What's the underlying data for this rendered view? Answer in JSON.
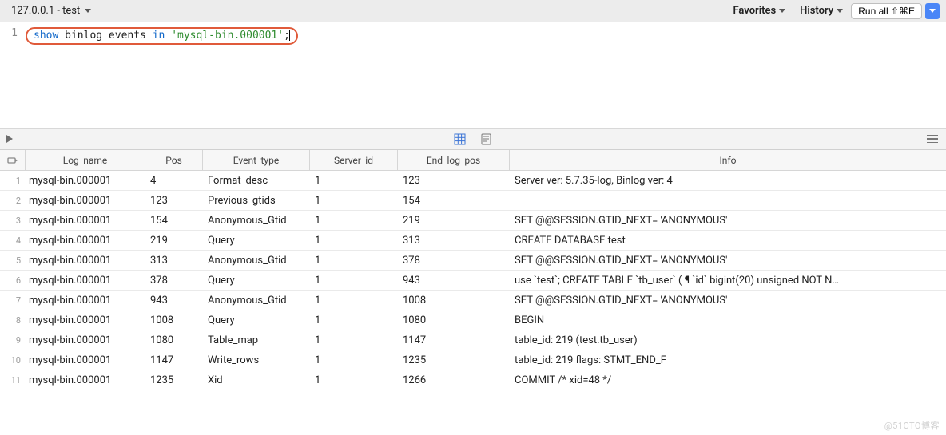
{
  "toolbar": {
    "tab_label": "127.0.0.1 - test",
    "favorites": "Favorites",
    "history": "History",
    "run_all": "Run all ⇧⌘E"
  },
  "editor": {
    "line_number": "1",
    "sql_kw1": "show",
    "sql_plain1": " binlog events ",
    "sql_kw2": "in",
    "sql_plain2": " ",
    "sql_string": "'mysql-bin.000001'",
    "sql_semicolon": ";"
  },
  "table": {
    "headers": {
      "log_name": "Log_name",
      "pos": "Pos",
      "event_type": "Event_type",
      "server_id": "Server_id",
      "end_log_pos": "End_log_pos",
      "info": "Info"
    },
    "rows": [
      {
        "n": "1",
        "log": "mysql-bin.000001",
        "pos": "4",
        "evt": "Format_desc",
        "srv": "1",
        "end": "123",
        "info": "Server ver: 5.7.35-log, Binlog ver: 4"
      },
      {
        "n": "2",
        "log": "mysql-bin.000001",
        "pos": "123",
        "evt": "Previous_gtids",
        "srv": "1",
        "end": "154",
        "info": ""
      },
      {
        "n": "3",
        "log": "mysql-bin.000001",
        "pos": "154",
        "evt": "Anonymous_Gtid",
        "srv": "1",
        "end": "219",
        "info": "SET @@SESSION.GTID_NEXT= 'ANONYMOUS'"
      },
      {
        "n": "4",
        "log": "mysql-bin.000001",
        "pos": "219",
        "evt": "Query",
        "srv": "1",
        "end": "313",
        "info": "CREATE DATABASE test"
      },
      {
        "n": "5",
        "log": "mysql-bin.000001",
        "pos": "313",
        "evt": "Anonymous_Gtid",
        "srv": "1",
        "end": "378",
        "info": "SET @@SESSION.GTID_NEXT= 'ANONYMOUS'"
      },
      {
        "n": "6",
        "log": "mysql-bin.000001",
        "pos": "378",
        "evt": "Query",
        "srv": "1",
        "end": "943",
        "info": "use `test`; CREATE TABLE `tb_user` ( ¶   `id` bigint(20) unsigned NOT N…"
      },
      {
        "n": "7",
        "log": "mysql-bin.000001",
        "pos": "943",
        "evt": "Anonymous_Gtid",
        "srv": "1",
        "end": "1008",
        "info": "SET @@SESSION.GTID_NEXT= 'ANONYMOUS'"
      },
      {
        "n": "8",
        "log": "mysql-bin.000001",
        "pos": "1008",
        "evt": "Query",
        "srv": "1",
        "end": "1080",
        "info": "BEGIN"
      },
      {
        "n": "9",
        "log": "mysql-bin.000001",
        "pos": "1080",
        "evt": "Table_map",
        "srv": "1",
        "end": "1147",
        "info": "table_id: 219 (test.tb_user)"
      },
      {
        "n": "10",
        "log": "mysql-bin.000001",
        "pos": "1147",
        "evt": "Write_rows",
        "srv": "1",
        "end": "1235",
        "info": "table_id: 219 flags: STMT_END_F"
      },
      {
        "n": "11",
        "log": "mysql-bin.000001",
        "pos": "1235",
        "evt": "Xid",
        "srv": "1",
        "end": "1266",
        "info": "COMMIT /* xid=48 */"
      }
    ]
  },
  "watermark": "@51CTO博客"
}
